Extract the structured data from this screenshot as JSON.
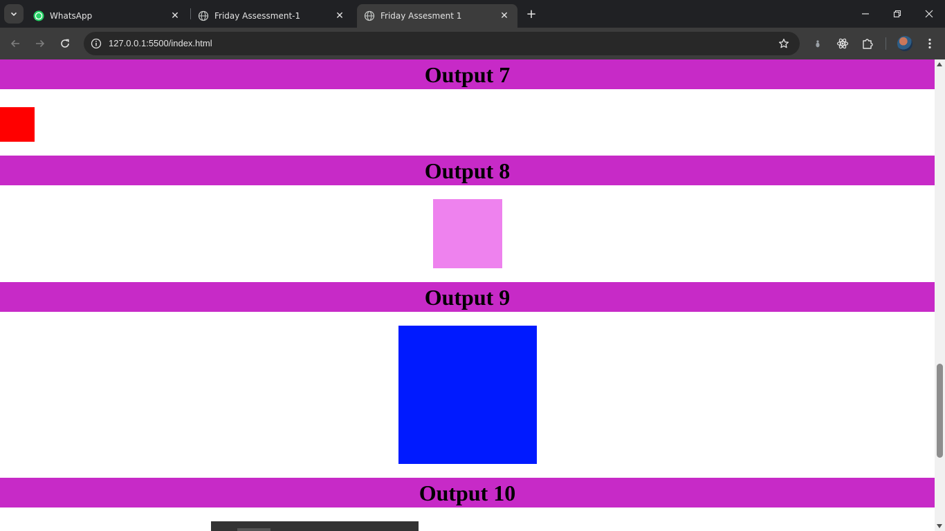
{
  "browser": {
    "tabs": [
      {
        "title": "WhatsApp",
        "icon": "whatsapp-icon",
        "active": false
      },
      {
        "title": "Friday Assessment-1",
        "icon": "globe-icon",
        "active": false
      },
      {
        "title": "Friday Assesment 1",
        "icon": "globe-icon",
        "active": true
      }
    ],
    "close_glyph": "✕",
    "new_tab_glyph": "+",
    "url": "127.0.0.1:5500/index.html"
  },
  "page": {
    "sections": [
      {
        "title": "Output 7",
        "box_color": "#ff0000"
      },
      {
        "title": "Output 8",
        "box_color": "#ee82ee"
      },
      {
        "title": "Output 9",
        "box_color": "#001aff"
      },
      {
        "title": "Output 10",
        "box_color": "#333333"
      }
    ],
    "heading_bg": "#c72ac7"
  }
}
